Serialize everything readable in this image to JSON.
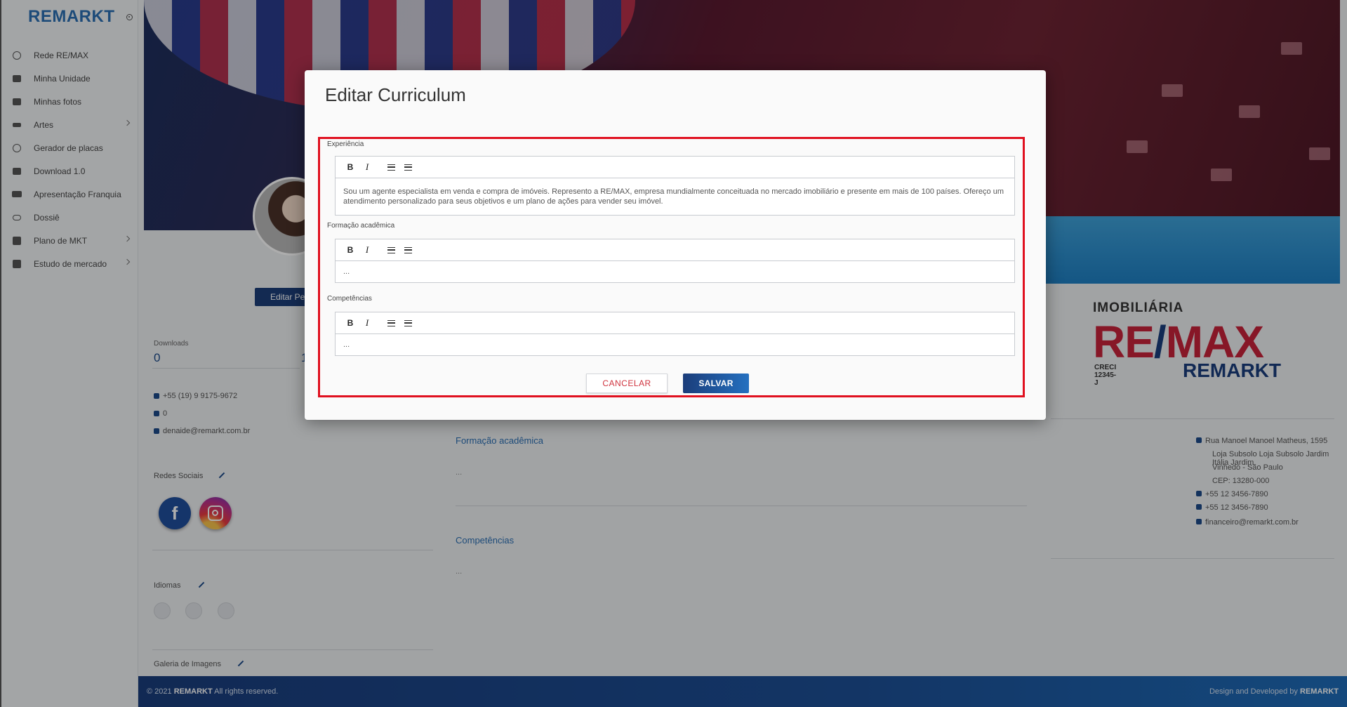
{
  "brand": {
    "name": "REMARKT"
  },
  "sidebar": {
    "items": [
      {
        "label": "Rede RE/MAX",
        "icon": "globe-icon",
        "chevron": false
      },
      {
        "label": "Minha Unidade",
        "icon": "building-icon",
        "chevron": false
      },
      {
        "label": "Minhas fotos",
        "icon": "photo-icon",
        "chevron": false
      },
      {
        "label": "Artes",
        "icon": "palette-icon",
        "chevron": true
      },
      {
        "label": "Gerador de placas",
        "icon": "circle-icon",
        "chevron": false
      },
      {
        "label": "Download 1.0",
        "icon": "download-icon",
        "chevron": false
      },
      {
        "label": "Apresentação Franquia",
        "icon": "presentation-icon",
        "chevron": false
      },
      {
        "label": "Dossiê",
        "icon": "link-icon",
        "chevron": false
      },
      {
        "label": "Plano de MKT",
        "icon": "checkbox-icon",
        "chevron": true
      },
      {
        "label": "Estudo de mercado",
        "icon": "chart-icon",
        "chevron": true
      }
    ]
  },
  "profile": {
    "edit_button": "Editar Pe",
    "downloads_label": "Downloads",
    "downloads_value": "0",
    "second_stat_value": "1",
    "phone": "+55 (19) 9 9175-9672",
    "phone2": "0",
    "email": "denaide@remarkt.com.br",
    "social_label": "Redes Sociais",
    "languages_label": "Idiomas",
    "gallery_label": "Galeria de Imagens"
  },
  "middle": {
    "formacao_heading": "Formação acadêmica",
    "formacao_value": "...",
    "competencias_heading": "Competências",
    "competencias_value": "..."
  },
  "agency": {
    "imobiliaria": "IMOBILIÁRIA",
    "logo_re": "RE",
    "logo_slash": "/",
    "logo_max": "MAX",
    "creci": "CRECI 12345-J",
    "logo_sub": "REMARKT",
    "address_line1": "Rua Manoel Manoel Matheus, 1595",
    "address_line2": "Loja Subsolo Loja Subsolo Jardim Itália Jardim",
    "address_line3": "Vinhedo - São Paulo",
    "address_line4": "CEP: 13280-000",
    "phone1": "+55 12 3456-7890",
    "phone2": "+55 12 3456-7890",
    "email": "financeiro@remarkt.com.br"
  },
  "footer": {
    "copyright_prefix": "© 2021",
    "copyright_brand": "REMARKT",
    "copyright_suffix": "All rights reserved.",
    "credit_prefix": "Design and Developed by",
    "credit_brand": "REMARKT"
  },
  "modal": {
    "title": "Editar Curriculum",
    "fields": [
      {
        "label": "Experiência",
        "content": "Sou um agente especialista em venda e compra de imóveis. Represento a RE/MAX, empresa mundialmente conceituada no mercado imobiliário e presente em mais de 100 países. Ofereço um atendimento personalizado para seus objetivos e um plano de ações para vender seu imóvel."
      },
      {
        "label": "Formação acadêmica",
        "content": "..."
      },
      {
        "label": "Competências",
        "content": "..."
      }
    ],
    "toolbar": {
      "bold": "B",
      "italic": "I"
    },
    "cancel_label": "CANCELAR",
    "save_label": "SALVAR"
  }
}
